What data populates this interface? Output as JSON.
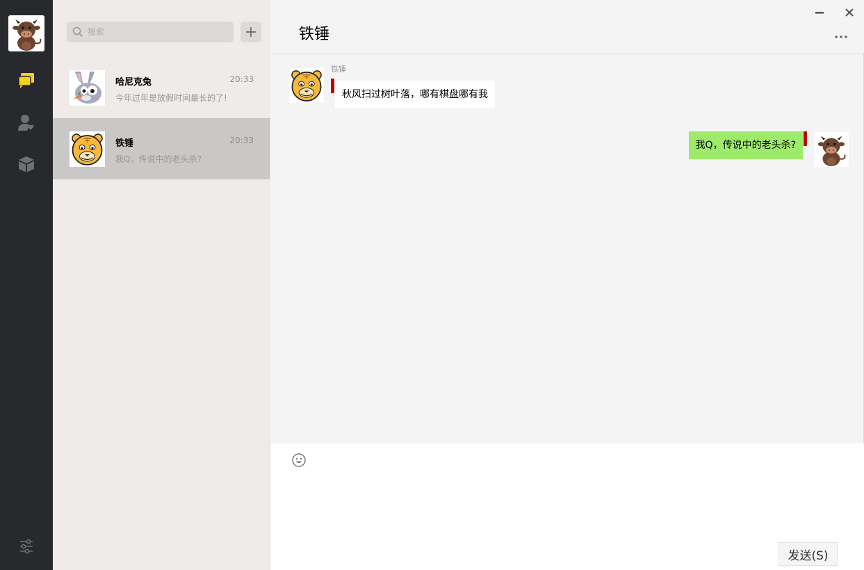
{
  "nav": {
    "avatar_icon": "cow-avatar",
    "items": [
      {
        "name": "chat",
        "icon": "chat-bubbles-icon",
        "active": true,
        "color": "#f5d21c"
      },
      {
        "name": "contacts",
        "icon": "contacts-icon",
        "active": false
      },
      {
        "name": "collections",
        "icon": "cube-icon",
        "active": false
      }
    ],
    "settings_icon": "settings-sliders-icon"
  },
  "search": {
    "placeholder": "搜索"
  },
  "conversations": [
    {
      "name": "哈尼克兔",
      "time": "20:33",
      "preview": "今年过年是放假时间最长的了!",
      "avatar": "rabbit-avatar",
      "active": false
    },
    {
      "name": "铁锤",
      "time": "20:33",
      "preview": "我Q，传说中的老头杀?",
      "avatar": "tiger-avatar",
      "active": true
    }
  ],
  "chat": {
    "title": "铁锤",
    "messages": [
      {
        "side": "left",
        "sender": "铁锤",
        "text": "秋风扫过树叶落，哪有棋盘哪有我",
        "avatar": "tiger-avatar"
      },
      {
        "side": "right",
        "sender": "",
        "text": "我Q，传说中的老头杀?",
        "avatar": "cow-avatar"
      }
    ]
  },
  "input": {
    "send_label": "发送(S)"
  },
  "colors": {
    "nav_bg": "#28292c",
    "list_bg": "#eeebe8",
    "active_item": "#cac8c6",
    "chat_bg": "#f4f4f4",
    "bubble_self": "#9eea6a",
    "bubble_other": "#ffffff",
    "accent": "#f5d21c",
    "alert_mark": "#c00000"
  }
}
